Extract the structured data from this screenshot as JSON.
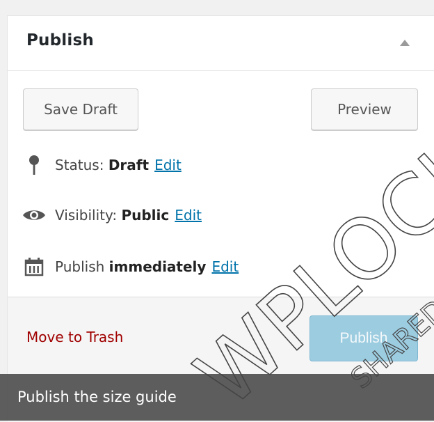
{
  "metabox": {
    "title": "Publish"
  },
  "buttons": {
    "save_draft": "Save Draft",
    "preview": "Preview",
    "publish": "Publish"
  },
  "status": {
    "label": "Status:",
    "value": "Draft",
    "edit": "Edit",
    "icon": "pin-icon"
  },
  "visibility": {
    "label": "Visibility:",
    "value": "Public",
    "edit": "Edit",
    "icon": "eye-icon"
  },
  "schedule": {
    "label": "Publish",
    "value": "immediately",
    "edit": "Edit",
    "icon": "calendar-icon"
  },
  "actions": {
    "trash": "Move to Trash"
  },
  "caption": {
    "text": "Publish the size guide"
  },
  "watermark": {
    "line1": "WPLOCKER",
    "line2": "SHARED"
  },
  "colors": {
    "link": "#0073aa",
    "trash": "#a00000",
    "publish_bg": "#9ccce0"
  }
}
